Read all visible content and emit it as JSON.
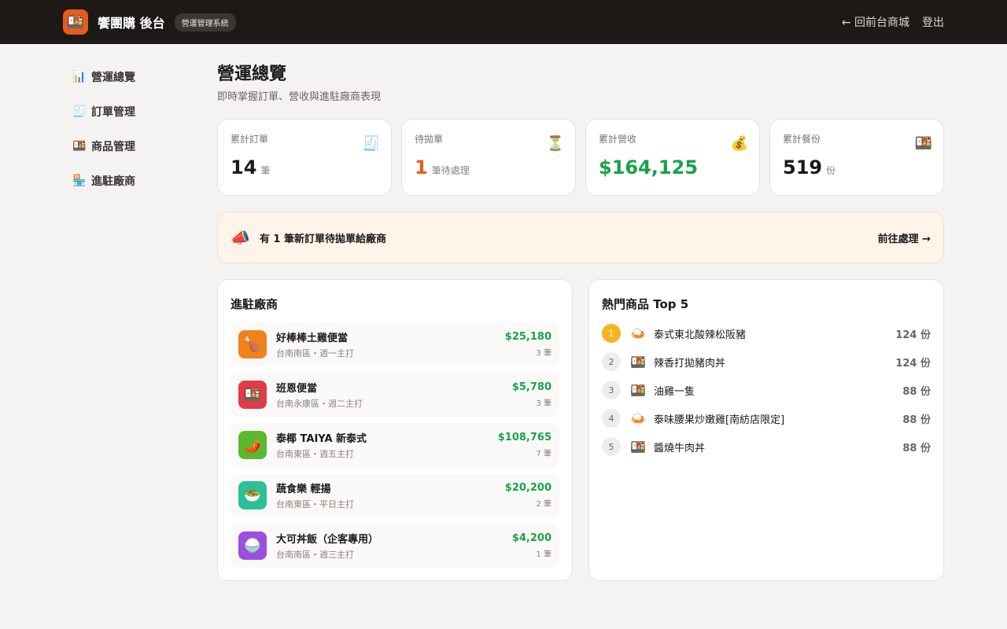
{
  "header": {
    "logo_icon": "🍱",
    "brand": "饗團購 後台",
    "badge": "營運管理系統",
    "back_link": "← 回前台商城",
    "logout": "登出"
  },
  "sidebar": {
    "items": [
      {
        "icon": "📊",
        "label": "營運總覽"
      },
      {
        "icon": "🧾",
        "label": "訂單管理"
      },
      {
        "icon": "🍱",
        "label": "商品管理"
      },
      {
        "icon": "🏪",
        "label": "進駐廠商"
      }
    ]
  },
  "page": {
    "title": "營運總覽",
    "subtitle": "即時掌握訂單、營收與進駐廠商表現"
  },
  "stats": [
    {
      "label": "累計訂單",
      "icon": "🧾",
      "value": "14",
      "unit": "筆"
    },
    {
      "label": "待拋單",
      "icon": "⏳",
      "value": "1",
      "unit": "筆待處理"
    },
    {
      "label": "累計營收",
      "icon": "💰",
      "value": "$164,125",
      "unit": ""
    },
    {
      "label": "累計餐份",
      "icon": "🍱",
      "value": "519",
      "unit": "份"
    }
  ],
  "alert": {
    "icon": "📣",
    "text": "有 1 筆新訂單待拋單給廠商",
    "link": "前往處理 →"
  },
  "vendors": {
    "title": "進駐廠商",
    "items": [
      {
        "icon": "🍗",
        "color": "#f0821c",
        "name": "好棒棒土雞便當",
        "meta": "台南南區・週一主打",
        "amount": "$25,180",
        "count": "3 筆"
      },
      {
        "icon": "🍱",
        "color": "#e33a4a",
        "name": "班恩便當",
        "meta": "台南永康區・週二主打",
        "amount": "$5,780",
        "count": "3 筆"
      },
      {
        "icon": "🌶️",
        "color": "#5cb82e",
        "name": "泰椰 TAIYA 新泰式",
        "meta": "台南東區・週五主打",
        "amount": "$108,765",
        "count": "7 筆"
      },
      {
        "icon": "🥗",
        "color": "#2bbf9a",
        "name": "蔬食樂 輕揚",
        "meta": "台南東區・平日主打",
        "amount": "$20,200",
        "count": "2 筆"
      },
      {
        "icon": "🍚",
        "color": "#9b4ee0",
        "name": "大可丼飯（企客專用）",
        "meta": "台南南區・週三主打",
        "amount": "$4,200",
        "count": "1 筆"
      }
    ]
  },
  "top_products": {
    "title": "熱門商品 Top 5",
    "items": [
      {
        "rank": "1",
        "icon": "🍛",
        "name": "泰式東北酸辣松阪豬",
        "qty": "124 份"
      },
      {
        "rank": "2",
        "icon": "🍱",
        "name": "辣香打拋豬肉丼",
        "qty": "124 份"
      },
      {
        "rank": "3",
        "icon": "🍱",
        "name": "油雞一隻",
        "qty": "88 份"
      },
      {
        "rank": "4",
        "icon": "🍛",
        "name": "泰味腰果炒嫩雞[南紡店限定]",
        "qty": "88 份"
      },
      {
        "rank": "5",
        "icon": "🍱",
        "name": "醬燒牛肉丼",
        "qty": "88 份"
      }
    ]
  }
}
